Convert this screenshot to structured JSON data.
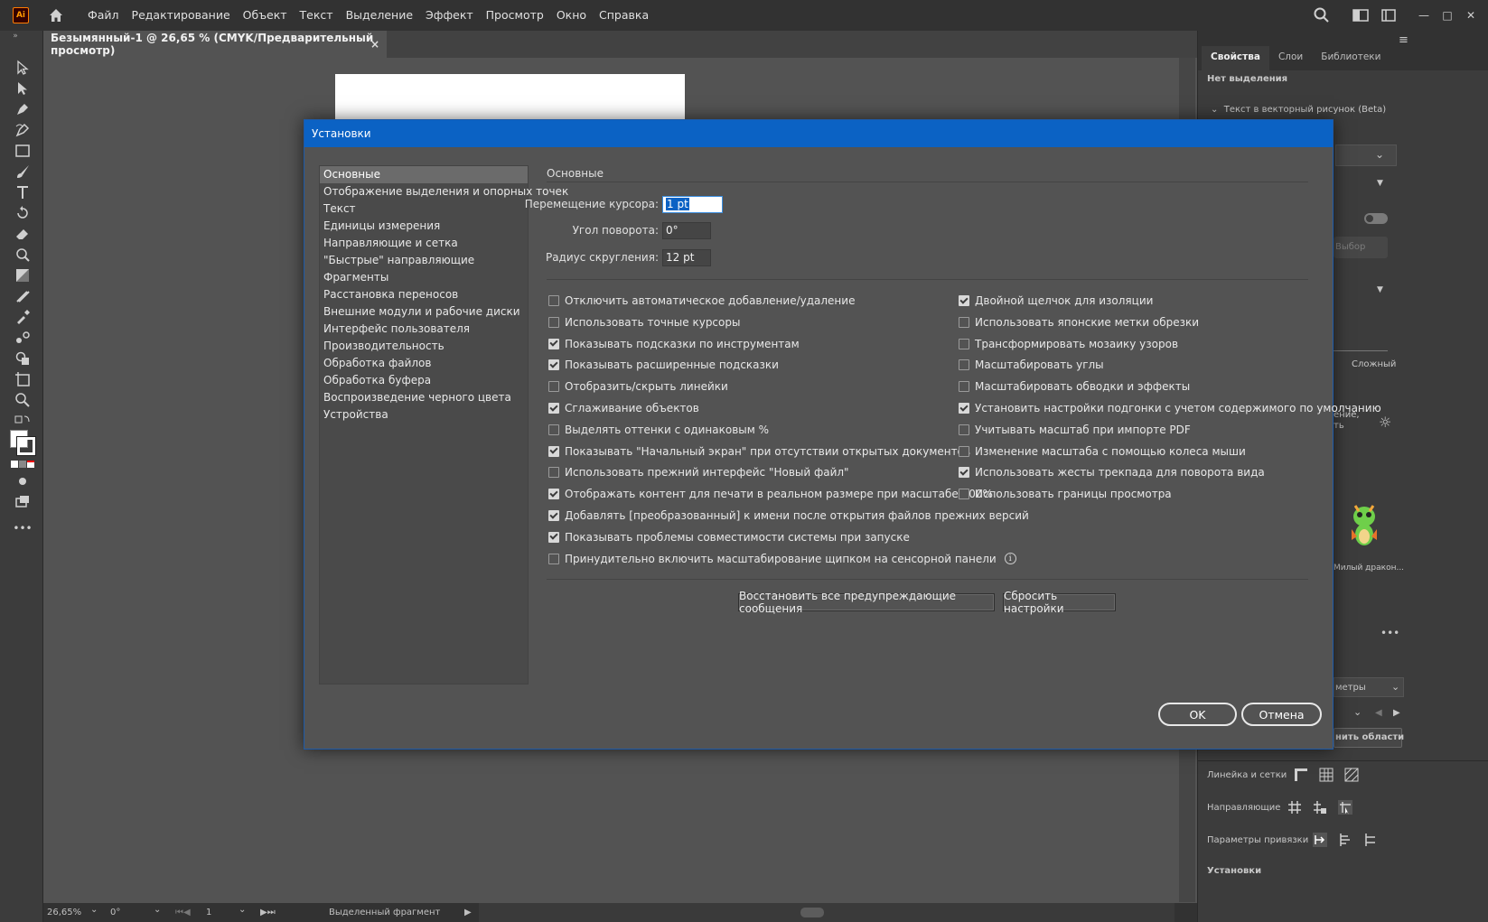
{
  "app": {
    "logo_text": "Ai",
    "menus": [
      "Файл",
      "Редактирование",
      "Объект",
      "Текст",
      "Выделение",
      "Эффект",
      "Просмотр",
      "Окно",
      "Справка"
    ]
  },
  "document_tab": {
    "title": "Безымянный-1 @ 26,65 % (CMYK/Предварительный просмотр)",
    "close": "×"
  },
  "right_panel": {
    "tabs": [
      "Свойства",
      "Слои",
      "Библиотеки"
    ],
    "no_selection": "Нет выделения",
    "text_to_vector": "Текст в векторный рисунок (Beta)",
    "choose": "Выбор",
    "complex": "Сложный",
    "partial_text_1": "ение,",
    "partial_text_2": "ть",
    "dragon_label": "Милый дракон...",
    "params_partial": "метры",
    "areas_partial": "нить области",
    "rulers_grids": "Линейка и сетки",
    "guides": "Направляющие",
    "snap_options": "Параметры привязки",
    "settings_partial": "Установки",
    "more": "•••"
  },
  "status_bar": {
    "zoom": "26,65%",
    "rotation": "0°",
    "artboard": "1",
    "selection_tool": "Выделенный фрагмент"
  },
  "dialog": {
    "title": "Установки",
    "categories": [
      "Основные",
      "Отображение выделения и опорных точек",
      "Текст",
      "Единицы измерения",
      "Направляющие и сетка",
      "\"Быстрые\" направляющие",
      "Фрагменты",
      "Расстановка переносов",
      "Внешние модули и рабочие диски",
      "Интерфейс пользователя",
      "Производительность",
      "Обработка файлов",
      "Обработка буфера",
      "Воспроизведение черного цвета",
      "Устройства"
    ],
    "selected_category": "Основные",
    "section_title": "Основные",
    "fields": {
      "keyboard_increment": {
        "label": "Перемещение курсора:",
        "value": "1 pt"
      },
      "constrain_angle": {
        "label": "Угол поворота:",
        "value": "0°"
      },
      "corner_radius": {
        "label": "Радиус скругления:",
        "value": "12 pt"
      }
    },
    "left_options": [
      {
        "label": "Отключить автоматическое добавление/удаление",
        "checked": false
      },
      {
        "label": "Использовать точные курсоры",
        "checked": false
      },
      {
        "label": "Показывать подсказки по инструментам",
        "checked": true
      },
      {
        "label": "Показывать расширенные подсказки",
        "checked": true
      },
      {
        "label": "Отобразить/скрыть линейки",
        "checked": false
      },
      {
        "label": "Сглаживание объектов",
        "checked": true
      },
      {
        "label": "Выделять оттенки с одинаковым %",
        "checked": false
      },
      {
        "label": "Показывать \"Начальный экран\" при отсутствии открытых документов",
        "checked": true
      },
      {
        "label": "Использовать прежний интерфейс \"Новый файл\"",
        "checked": false
      },
      {
        "label": "Отображать контент для печати в реальном размере при масштабе 100%",
        "checked": true
      },
      {
        "label": "Добавлять [преобразованный] к имени после открытия файлов прежних версий",
        "checked": true
      },
      {
        "label": "Показывать проблемы совместимости системы при запуске",
        "checked": true
      },
      {
        "label": "Принудительно включить масштабирование щипком на сенсорной панели",
        "checked": false
      }
    ],
    "right_options": [
      {
        "label": "Двойной щелчок для изоляции",
        "checked": true
      },
      {
        "label": "Использовать японские метки обрезки",
        "checked": false
      },
      {
        "label": "Трансформировать мозаику узоров",
        "checked": false
      },
      {
        "label": "Масштабировать углы",
        "checked": false
      },
      {
        "label": "Масштабировать обводки и эффекты",
        "checked": false
      },
      {
        "label": "Установить настройки подгонки с учетом содержимого по умолчанию",
        "checked": true
      },
      {
        "label": "Учитывать масштаб при импорте PDF",
        "checked": false
      },
      {
        "label": "Изменение масштаба с помощью колеса мыши",
        "checked": false
      },
      {
        "label": "Использовать жесты трекпада для поворота вида",
        "checked": true
      },
      {
        "label": "Использовать границы просмотра",
        "checked": false
      }
    ],
    "info_icon": "i",
    "reset_warnings": "Восстановить все предупреждающие сообщения",
    "reset_prefs": "Сбросить настройки",
    "ok": "OK",
    "cancel": "Отмена"
  }
}
